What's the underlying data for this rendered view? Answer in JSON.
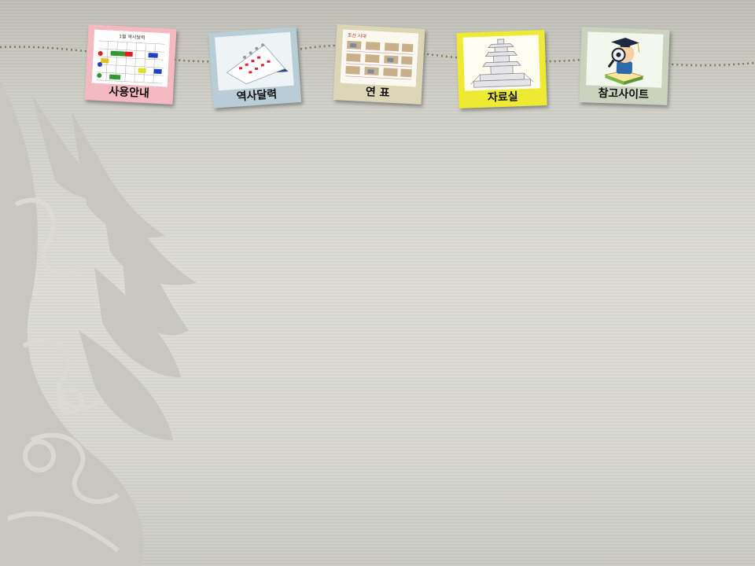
{
  "nav": {
    "items": [
      {
        "id": "guide",
        "label": "사용안내",
        "frame_color": "#f4b9c1"
      },
      {
        "id": "calendar",
        "label": "역사달력",
        "frame_color": "#b9cdd6"
      },
      {
        "id": "timeline",
        "label": "연 표",
        "frame_color": "#ddd6b6"
      },
      {
        "id": "archive",
        "label": "자료실",
        "frame_color": "#eeea33"
      },
      {
        "id": "links",
        "label": "참고사이트",
        "frame_color": "#cbd3bf"
      }
    ]
  },
  "thumb_guide": {
    "heading": "1월 역사달력"
  },
  "thumb_timeline": {
    "heading": "조선 시대"
  },
  "colors": {
    "background": "#d4d4cd",
    "ornament": "#c6c6bf",
    "string": "#7f7a52"
  }
}
